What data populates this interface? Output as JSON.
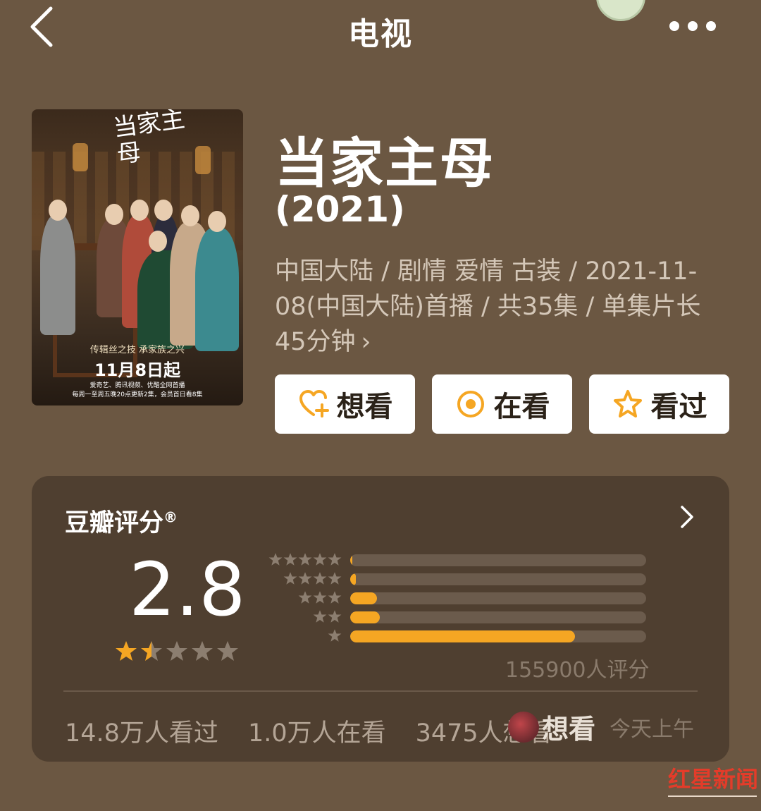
{
  "header": {
    "title": "电视",
    "back_icon": "chevron-left-icon",
    "more_icon": "more-horizontal-icon"
  },
  "poster": {
    "calligraphy": "当家主母",
    "tagline": "传辑丝之技 承家族之兴",
    "date": "11月8日起",
    "sub_line1": "爱奇艺、腾讯视频、优酷全网首播",
    "sub_line2": "每周一至周五晚20点更新2集，会员首日看8集"
  },
  "show": {
    "title": "当家主母",
    "year": "(2021)",
    "meta": "中国大陆 / 剧情 爱情 古装 / 2021-11-08(中国大陆)首播 / 共35集 / 单集片长45分钟",
    "meta_chevron": "›"
  },
  "actions": {
    "want_label": "想看",
    "watching_label": "在看",
    "watched_label": "看过",
    "accent_color": "#f5a623"
  },
  "rating": {
    "title": "豆瓣评分",
    "registered": "®",
    "score": "2.8",
    "star_value": 1.5,
    "distribution": [
      {
        "stars": 5,
        "percent": 0.6
      },
      {
        "stars": 4,
        "percent": 2.0
      },
      {
        "stars": 3,
        "percent": 9.0
      },
      {
        "stars": 2,
        "percent": 10.0
      },
      {
        "stars": 1,
        "percent": 76.0
      }
    ],
    "count": "155900人评分"
  },
  "stats": {
    "watched": "14.8万人看过",
    "watching": "1.0万人在看",
    "want_prefix": "3475人想看",
    "overlay_label": "想看",
    "overlay_time": "今天上午"
  },
  "watermark": {
    "text": "红星新闻"
  }
}
